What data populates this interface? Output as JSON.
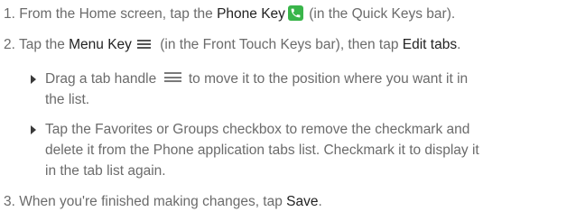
{
  "steps": {
    "s1": {
      "num": "1.",
      "pre": "From the Home screen, tap the ",
      "key": "Phone Key",
      "post": " (in the Quick Keys bar)."
    },
    "s2": {
      "num": "2.",
      "pre": "Tap the ",
      "key": "Menu Key",
      "mid": " (in the Front Touch Keys bar), then tap ",
      "action": "Edit tabs",
      "end": ".",
      "b1_line1_pre": "Drag a tab handle ",
      "b1_line1_post": " to move it to the position where you want it in",
      "b1_line2": "the list.",
      "b2_line1": "Tap the Favorites or Groups checkbox to remove the checkmark and",
      "b2_line2": "delete it from the Phone application tabs list. Checkmark it to display it",
      "b2_line3": "in the tab list again."
    },
    "s3": {
      "num": "3.",
      "pre": "When you're finished making changes, tap ",
      "action": "Save",
      "end": "."
    }
  },
  "icons": {
    "phone": "phone-key-icon",
    "menu": "menu-key-icon",
    "handle": "tab-handle-icon"
  },
  "colors": {
    "body_text": "#6b6b6b",
    "emphasis": "#222222",
    "phone_icon_bg": "#39b54a"
  }
}
